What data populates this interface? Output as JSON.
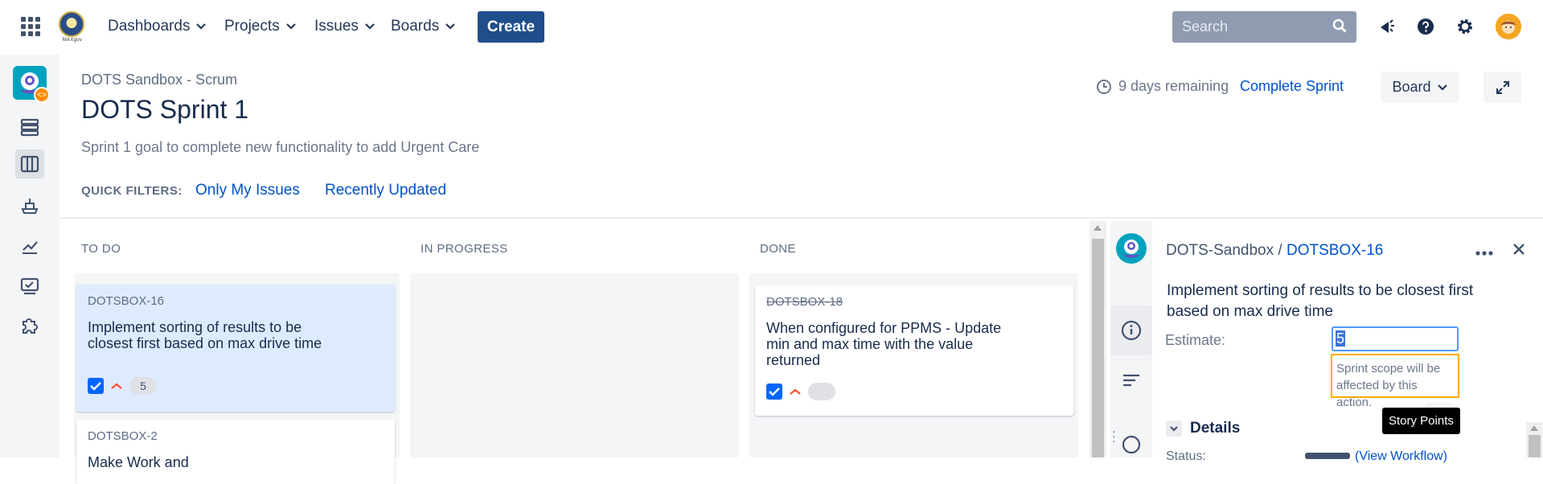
{
  "topnav": {
    "logo_text": "MAXgov",
    "items": [
      {
        "label": "Dashboards"
      },
      {
        "label": "Projects"
      },
      {
        "label": "Issues"
      },
      {
        "label": "Boards"
      }
    ],
    "create_label": "Create",
    "search_placeholder": "Search",
    "icons": [
      "apps-grid-icon",
      "megaphone-icon",
      "help-icon",
      "gear-icon",
      "user-avatar"
    ]
  },
  "sidebar": {
    "icons": [
      "project-avatar",
      "backlog-icon",
      "board-icon",
      "releases-icon",
      "reports-icon",
      "issues-icon",
      "add-ons-icon"
    ],
    "active": "board-icon"
  },
  "header": {
    "breadcrumb": "DOTS Sandbox - Scrum",
    "title": "DOTS Sprint 1",
    "sprint_goal": "Sprint 1 goal to complete new functionality to add Urgent Care",
    "remaining": "9 days remaining",
    "complete_sprint": "Complete Sprint",
    "board_button": "Board"
  },
  "quick_filters": {
    "label": "QUICK FILTERS:",
    "items": [
      "Only My Issues",
      "Recently Updated"
    ]
  },
  "columns": [
    {
      "name": "TO DO"
    },
    {
      "name": "IN PROGRESS"
    },
    {
      "name": "DONE"
    }
  ],
  "cards": {
    "todo": [
      {
        "key": "DOTSBOX-16",
        "summary": "Implement sorting of results to be closest first based on max drive time",
        "points": "5"
      },
      {
        "key": "DOTSBOX-2",
        "summary": "Make Work and"
      }
    ],
    "done": [
      {
        "key": "DOTSBOX-18",
        "summary": "When configured for PPMS - Update min and max time with the value returned",
        "points": ""
      }
    ]
  },
  "panel": {
    "project": "DOTS-Sandbox",
    "separator": "/",
    "issue_key": "DOTSBOX-16",
    "summary": "Implement sorting of results to be closest first based on max drive time",
    "estimate_label": "Estimate:",
    "estimate_value": "5",
    "warning": "Sprint scope will be affected by this action.",
    "tooltip": "Story Points",
    "details_label": "Details",
    "status_partial": "Status:",
    "workflow_partial": "(View Workflow)"
  },
  "colors": {
    "primary": "#0052cc",
    "create": "#1f4e8c",
    "warning_border": "#ffab00",
    "selected_card": "#deebff",
    "priority": "#ff5630"
  }
}
